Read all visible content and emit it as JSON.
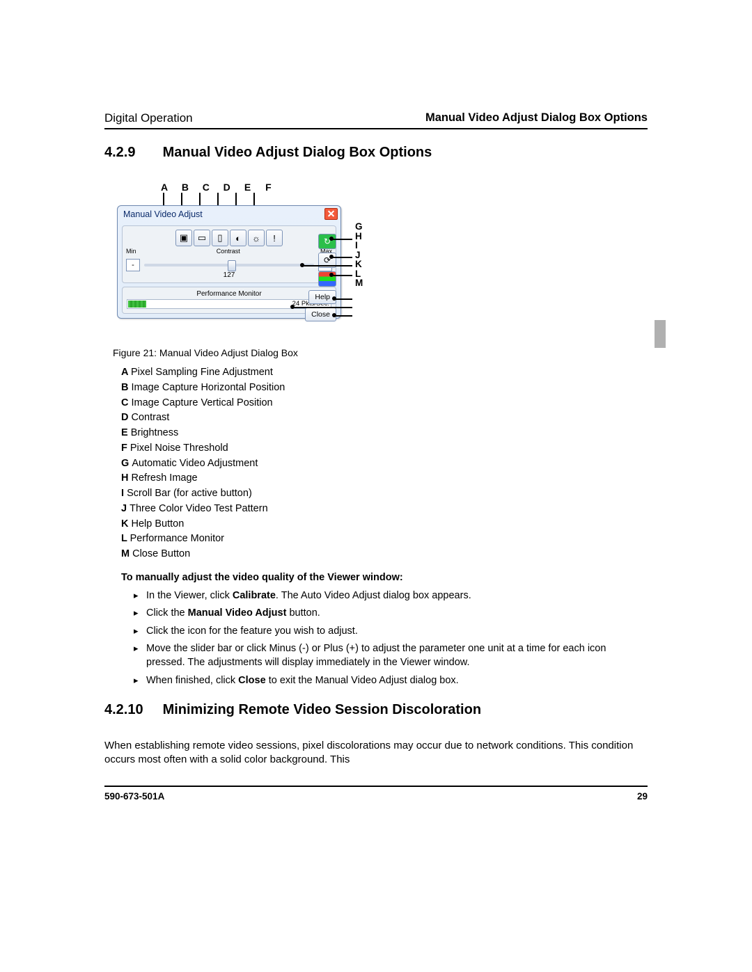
{
  "header": {
    "left": "Digital Operation",
    "right": "Manual Video Adjust Dialog Box Options"
  },
  "section429": {
    "num": "4.2.9",
    "title": "Manual Video Adjust Dialog Box Options"
  },
  "toplabels": [
    "A",
    "B",
    "C",
    "D",
    "E",
    "F"
  ],
  "rightlabels": [
    "G",
    "H",
    "I",
    "J",
    "K",
    "L",
    "M"
  ],
  "dialog": {
    "title": "Manual Video Adjust",
    "slider": {
      "min": "Min",
      "max": "Max",
      "label": "Contrast",
      "value": "127",
      "minus": "-",
      "plus": "+"
    },
    "perf": {
      "title": "Performance Monitor",
      "readout": "24  Pkts/Sec."
    },
    "help": "Help",
    "close": "Close"
  },
  "caption": "Figure 21:  Manual Video Adjust Dialog Box",
  "legend": [
    {
      "k": "A",
      "v": "Pixel Sampling Fine Adjustment"
    },
    {
      "k": "B",
      "v": "Image Capture Horizontal Position"
    },
    {
      "k": "C",
      "v": "Image Capture Vertical Position"
    },
    {
      "k": "D",
      "v": "Contrast"
    },
    {
      "k": "E",
      "v": "Brightness"
    },
    {
      "k": "F",
      "v": "Pixel Noise Threshold"
    },
    {
      "k": "G",
      "v": "Automatic Video Adjustment"
    },
    {
      "k": "H",
      "v": "Refresh Image"
    },
    {
      "k": "I",
      "v": "Scroll Bar (for active button)"
    },
    {
      "k": "J",
      "v": "Three Color Video Test Pattern"
    },
    {
      "k": "K",
      "v": "Help Button"
    },
    {
      "k": "L",
      "v": "Performance Monitor"
    },
    {
      "k": "M",
      "v": "Close Button"
    }
  ],
  "instr_head": "To manually adjust the video quality of the Viewer window:",
  "steps": {
    "s1a": "In the Viewer, click ",
    "s1b": "Calibrate",
    "s1c": ". The Auto Video Adjust dialog box appears.",
    "s2a": "Click the ",
    "s2b": "Manual Video Adjust",
    "s2c": " button.",
    "s3": "Click the icon for the feature you wish to adjust.",
    "s4": "Move the slider bar or click Minus (-) or Plus (+) to adjust the parameter one unit at a time for each icon pressed. The adjustments will display immediately in the Viewer window.",
    "s5a": "When finished, click ",
    "s5b": "Close",
    "s5c": " to exit the Manual Video Adjust dialog box."
  },
  "section4210": {
    "num": "4.2.10",
    "title": "Minimizing Remote Video Session Discoloration"
  },
  "para4210": "When establishing remote video sessions, pixel discolorations may occur due to network conditions. This condition occurs most often with a solid color background. This",
  "footer": {
    "doc": "590-673-501A",
    "page": "29"
  }
}
